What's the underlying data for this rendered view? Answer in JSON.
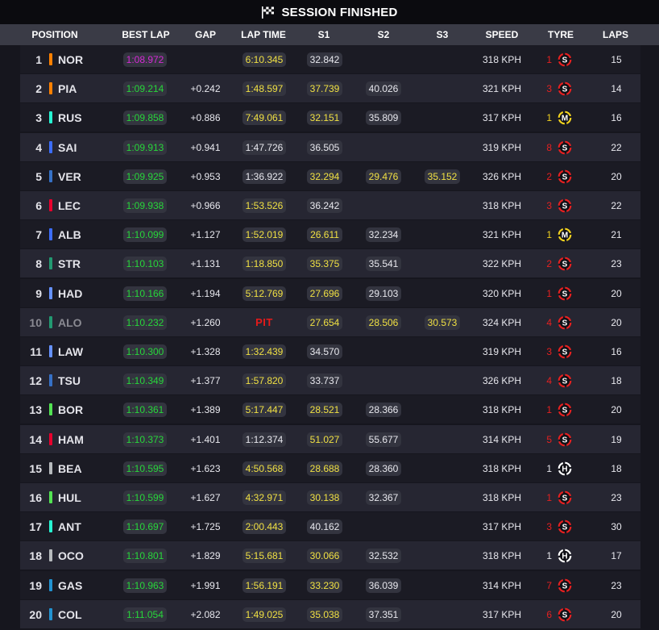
{
  "header": {
    "title": "SESSION FINISHED"
  },
  "columns": {
    "position": "POSITION",
    "best_lap": "BEST LAP",
    "gap": "GAP",
    "lap_time": "LAP TIME",
    "s1": "S1",
    "s2": "S2",
    "s3": "S3",
    "speed": "SPEED",
    "tyre": "TYRE",
    "laps": "LAPS"
  },
  "colors": {
    "purple_best": "#d62ad6",
    "green_best": "#27d63a",
    "yellow_sector": "#f0e043",
    "pit": "#e51a1a",
    "tyre_soft": "#e62020",
    "tyre_medium": "#f2d21f",
    "tyre_hard": "#ffffff"
  },
  "rows": [
    {
      "pos": "1",
      "code": "NOR",
      "team_color": "#ff8000",
      "best": "1:08.972",
      "best_cls": "purple",
      "gap": "",
      "lap": "6:10.345",
      "lap_cls": "yellow",
      "s1": "32.842",
      "s1_cls": "white",
      "s2": "",
      "s2_cls": "white",
      "s3": "",
      "s3_cls": "white",
      "speed": "318 KPH",
      "tyre_age": "1",
      "tyre": "S",
      "laps": "15",
      "dim": false,
      "pit": false
    },
    {
      "pos": "2",
      "code": "PIA",
      "team_color": "#ff8000",
      "best": "1:09.214",
      "best_cls": "green",
      "gap": "+0.242",
      "lap": "1:48.597",
      "lap_cls": "yellow",
      "s1": "37.739",
      "s1_cls": "yellow",
      "s2": "40.026",
      "s2_cls": "white",
      "s3": "",
      "s3_cls": "white",
      "speed": "321 KPH",
      "tyre_age": "3",
      "tyre": "S",
      "laps": "14",
      "dim": false,
      "pit": false
    },
    {
      "pos": "3",
      "code": "RUS",
      "team_color": "#27f4d2",
      "best": "1:09.858",
      "best_cls": "green",
      "gap": "+0.886",
      "lap": "7:49.061",
      "lap_cls": "yellow",
      "s1": "32.151",
      "s1_cls": "yellow",
      "s2": "35.809",
      "s2_cls": "white",
      "s3": "",
      "s3_cls": "white",
      "speed": "317 KPH",
      "tyre_age": "1",
      "tyre": "M",
      "laps": "16",
      "dim": false,
      "pit": false
    },
    {
      "pos": "4",
      "code": "SAI",
      "team_color": "#3c6dfa",
      "best": "1:09.913",
      "best_cls": "green",
      "gap": "+0.941",
      "lap": "1:47.726",
      "lap_cls": "white",
      "s1": "36.505",
      "s1_cls": "white",
      "s2": "",
      "s2_cls": "white",
      "s3": "",
      "s3_cls": "white",
      "speed": "319 KPH",
      "tyre_age": "8",
      "tyre": "S",
      "laps": "22",
      "dim": false,
      "pit": false
    },
    {
      "pos": "5",
      "code": "VER",
      "team_color": "#3671c6",
      "best": "1:09.925",
      "best_cls": "green",
      "gap": "+0.953",
      "lap": "1:36.922",
      "lap_cls": "white",
      "s1": "32.294",
      "s1_cls": "yellow",
      "s2": "29.476",
      "s2_cls": "yellow",
      "s3": "35.152",
      "s3_cls": "yellow",
      "speed": "326 KPH",
      "tyre_age": "2",
      "tyre": "S",
      "laps": "20",
      "dim": false,
      "pit": false
    },
    {
      "pos": "6",
      "code": "LEC",
      "team_color": "#e8002d",
      "best": "1:09.938",
      "best_cls": "green",
      "gap": "+0.966",
      "lap": "1:53.526",
      "lap_cls": "yellow",
      "s1": "36.242",
      "s1_cls": "white",
      "s2": "",
      "s2_cls": "white",
      "s3": "",
      "s3_cls": "white",
      "speed": "318 KPH",
      "tyre_age": "3",
      "tyre": "S",
      "laps": "22",
      "dim": false,
      "pit": false
    },
    {
      "pos": "7",
      "code": "ALB",
      "team_color": "#3c6dfa",
      "best": "1:10.099",
      "best_cls": "green",
      "gap": "+1.127",
      "lap": "1:52.019",
      "lap_cls": "yellow",
      "s1": "26.611",
      "s1_cls": "yellow",
      "s2": "32.234",
      "s2_cls": "white",
      "s3": "",
      "s3_cls": "white",
      "speed": "321 KPH",
      "tyre_age": "1",
      "tyre": "M",
      "laps": "21",
      "dim": false,
      "pit": false
    },
    {
      "pos": "8",
      "code": "STR",
      "team_color": "#229971",
      "best": "1:10.103",
      "best_cls": "green",
      "gap": "+1.131",
      "lap": "1:18.850",
      "lap_cls": "yellow",
      "s1": "35.375",
      "s1_cls": "yellow",
      "s2": "35.541",
      "s2_cls": "white",
      "s3": "",
      "s3_cls": "white",
      "speed": "322 KPH",
      "tyre_age": "2",
      "tyre": "S",
      "laps": "23",
      "dim": false,
      "pit": false
    },
    {
      "pos": "9",
      "code": "HAD",
      "team_color": "#6692ff",
      "best": "1:10.166",
      "best_cls": "green",
      "gap": "+1.194",
      "lap": "5:12.769",
      "lap_cls": "yellow",
      "s1": "27.696",
      "s1_cls": "yellow",
      "s2": "29.103",
      "s2_cls": "white",
      "s3": "",
      "s3_cls": "white",
      "speed": "320 KPH",
      "tyre_age": "1",
      "tyre": "S",
      "laps": "20",
      "dim": false,
      "pit": false
    },
    {
      "pos": "10",
      "code": "ALO",
      "team_color": "#229971",
      "best": "1:10.232",
      "best_cls": "green",
      "gap": "+1.260",
      "lap": "PIT",
      "lap_cls": "white",
      "s1": "27.654",
      "s1_cls": "yellow",
      "s2": "28.506",
      "s2_cls": "yellow",
      "s3": "30.573",
      "s3_cls": "yellow",
      "speed": "324 KPH",
      "tyre_age": "4",
      "tyre": "S",
      "laps": "20",
      "dim": true,
      "pit": true
    },
    {
      "pos": "11",
      "code": "LAW",
      "team_color": "#6692ff",
      "best": "1:10.300",
      "best_cls": "green",
      "gap": "+1.328",
      "lap": "1:32.439",
      "lap_cls": "yellow",
      "s1": "34.570",
      "s1_cls": "white",
      "s2": "",
      "s2_cls": "white",
      "s3": "",
      "s3_cls": "white",
      "speed": "319 KPH",
      "tyre_age": "3",
      "tyre": "S",
      "laps": "16",
      "dim": false,
      "pit": false
    },
    {
      "pos": "12",
      "code": "TSU",
      "team_color": "#3671c6",
      "best": "1:10.349",
      "best_cls": "green",
      "gap": "+1.377",
      "lap": "1:57.820",
      "lap_cls": "yellow",
      "s1": "33.737",
      "s1_cls": "white",
      "s2": "",
      "s2_cls": "white",
      "s3": "",
      "s3_cls": "white",
      "speed": "326 KPH",
      "tyre_age": "4",
      "tyre": "S",
      "laps": "18",
      "dim": false,
      "pit": false
    },
    {
      "pos": "13",
      "code": "BOR",
      "team_color": "#52e252",
      "best": "1:10.361",
      "best_cls": "green",
      "gap": "+1.389",
      "lap": "5:17.447",
      "lap_cls": "yellow",
      "s1": "28.521",
      "s1_cls": "yellow",
      "s2": "28.366",
      "s2_cls": "white",
      "s3": "",
      "s3_cls": "white",
      "speed": "318 KPH",
      "tyre_age": "1",
      "tyre": "S",
      "laps": "20",
      "dim": false,
      "pit": false
    },
    {
      "pos": "14",
      "code": "HAM",
      "team_color": "#e8002d",
      "best": "1:10.373",
      "best_cls": "green",
      "gap": "+1.401",
      "lap": "1:12.374",
      "lap_cls": "white",
      "s1": "51.027",
      "s1_cls": "yellow",
      "s2": "55.677",
      "s2_cls": "white",
      "s3": "",
      "s3_cls": "white",
      "speed": "314 KPH",
      "tyre_age": "5",
      "tyre": "S",
      "laps": "19",
      "dim": false,
      "pit": false
    },
    {
      "pos": "15",
      "code": "BEA",
      "team_color": "#b6babd",
      "best": "1:10.595",
      "best_cls": "green",
      "gap": "+1.623",
      "lap": "4:50.568",
      "lap_cls": "yellow",
      "s1": "28.688",
      "s1_cls": "yellow",
      "s2": "28.360",
      "s2_cls": "white",
      "s3": "",
      "s3_cls": "white",
      "speed": "318 KPH",
      "tyre_age": "1",
      "tyre": "H",
      "laps": "18",
      "dim": false,
      "pit": false
    },
    {
      "pos": "16",
      "code": "HUL",
      "team_color": "#52e252",
      "best": "1:10.599",
      "best_cls": "green",
      "gap": "+1.627",
      "lap": "4:32.971",
      "lap_cls": "yellow",
      "s1": "30.138",
      "s1_cls": "yellow",
      "s2": "32.367",
      "s2_cls": "white",
      "s3": "",
      "s3_cls": "white",
      "speed": "318 KPH",
      "tyre_age": "1",
      "tyre": "S",
      "laps": "23",
      "dim": false,
      "pit": false
    },
    {
      "pos": "17",
      "code": "ANT",
      "team_color": "#27f4d2",
      "best": "1:10.697",
      "best_cls": "green",
      "gap": "+1.725",
      "lap": "2:00.443",
      "lap_cls": "yellow",
      "s1": "40.162",
      "s1_cls": "white",
      "s2": "",
      "s2_cls": "white",
      "s3": "",
      "s3_cls": "white",
      "speed": "317 KPH",
      "tyre_age": "3",
      "tyre": "S",
      "laps": "30",
      "dim": false,
      "pit": false
    },
    {
      "pos": "18",
      "code": "OCO",
      "team_color": "#b6babd",
      "best": "1:10.801",
      "best_cls": "green",
      "gap": "+1.829",
      "lap": "5:15.681",
      "lap_cls": "yellow",
      "s1": "30.066",
      "s1_cls": "yellow",
      "s2": "32.532",
      "s2_cls": "white",
      "s3": "",
      "s3_cls": "white",
      "speed": "318 KPH",
      "tyre_age": "1",
      "tyre": "H",
      "laps": "17",
      "dim": false,
      "pit": false
    },
    {
      "pos": "19",
      "code": "GAS",
      "team_color": "#2293d1",
      "best": "1:10.963",
      "best_cls": "green",
      "gap": "+1.991",
      "lap": "1:56.191",
      "lap_cls": "yellow",
      "s1": "33.230",
      "s1_cls": "yellow",
      "s2": "36.039",
      "s2_cls": "white",
      "s3": "",
      "s3_cls": "white",
      "speed": "314 KPH",
      "tyre_age": "7",
      "tyre": "S",
      "laps": "23",
      "dim": false,
      "pit": false
    },
    {
      "pos": "20",
      "code": "COL",
      "team_color": "#2293d1",
      "best": "1:11.054",
      "best_cls": "green",
      "gap": "+2.082",
      "lap": "1:49.025",
      "lap_cls": "yellow",
      "s1": "35.038",
      "s1_cls": "yellow",
      "s2": "37.351",
      "s2_cls": "white",
      "s3": "",
      "s3_cls": "white",
      "speed": "317 KPH",
      "tyre_age": "6",
      "tyre": "S",
      "laps": "20",
      "dim": false,
      "pit": false
    }
  ]
}
